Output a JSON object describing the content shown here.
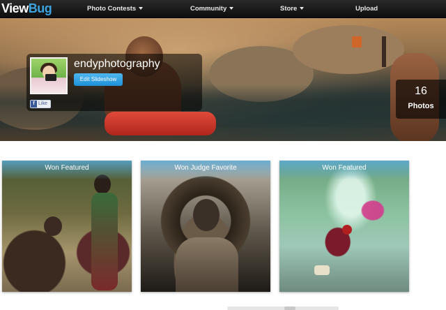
{
  "brand": {
    "logo_part1": "View",
    "logo_part2": "Bug"
  },
  "nav": {
    "items": [
      {
        "label": "Photo Contests",
        "dropdown": true
      },
      {
        "label": "Community",
        "dropdown": true
      },
      {
        "label": "Store",
        "dropdown": true
      },
      {
        "label": "Upload",
        "dropdown": false
      }
    ]
  },
  "profile": {
    "username": "endyphotography",
    "edit_slideshow_label": "Edit Slideshow",
    "fb_like_label": "Like",
    "fb_icon_glyph": "f",
    "photo_count": "16",
    "photo_count_label": "Photos"
  },
  "photos": [
    {
      "badge": "Won Featured",
      "icon": "photo-children-waterfall"
    },
    {
      "badge": "Won Judge Favorite",
      "icon": "photo-boy-hat"
    },
    {
      "badge": "Won Featured",
      "icon": "photo-woman-splash"
    }
  ],
  "colors": {
    "accent": "#1e90d8",
    "logo_blue": "#3aa3e0",
    "navbar": "#111111"
  }
}
